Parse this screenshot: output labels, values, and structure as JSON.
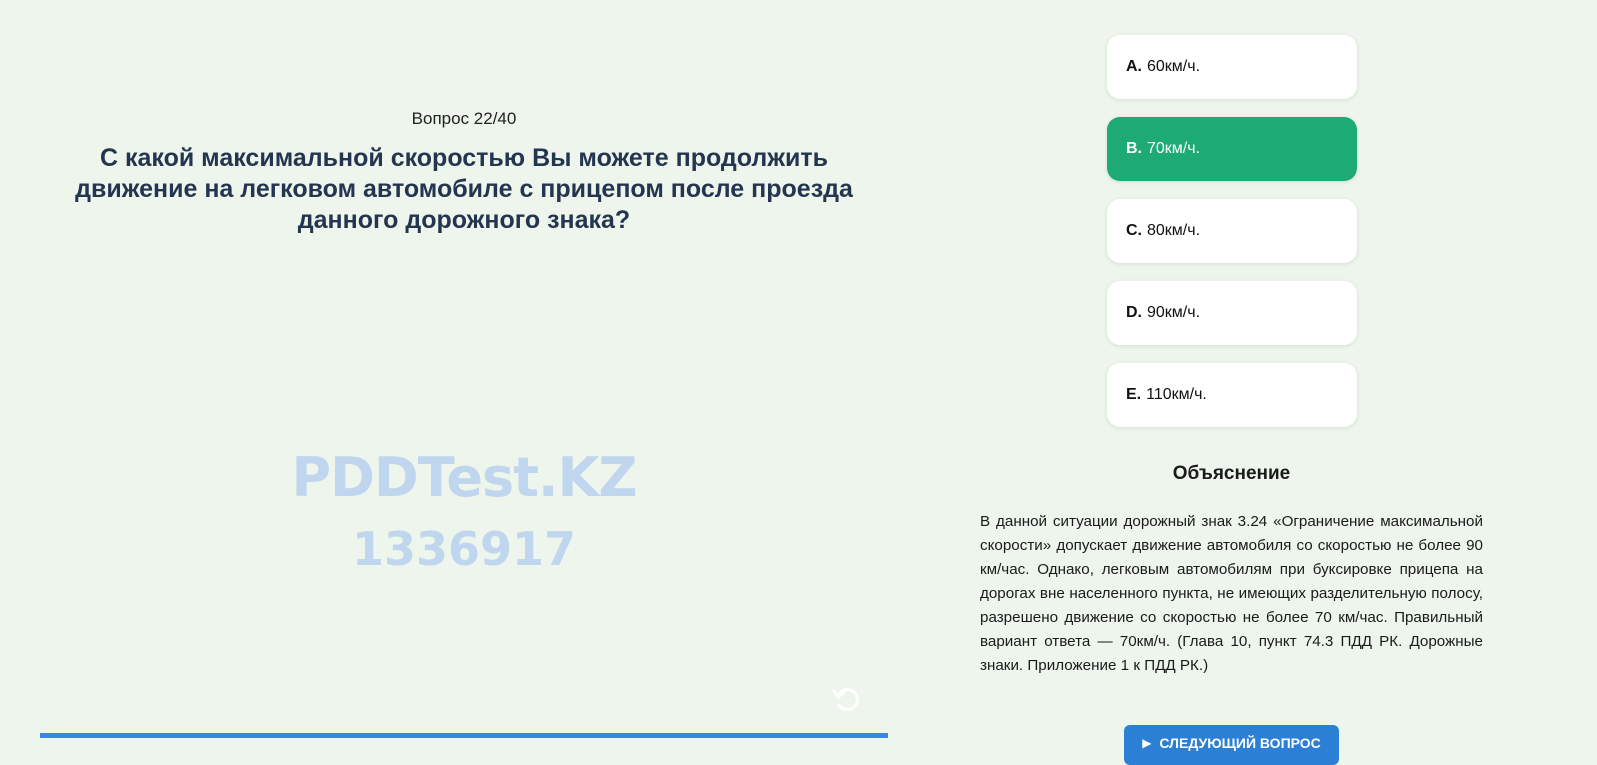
{
  "question": {
    "counter": "Вопрос 22/40",
    "text": "С какой максимальной скоростью Вы можете продолжить движение на легковом автомобиле с прицепом после проезда данного дорожного знака?"
  },
  "watermark": {
    "line1": "PDDTest.KZ",
    "line2": "1336917"
  },
  "progress": {
    "fraction": 1.0
  },
  "options": [
    {
      "letter": "A.",
      "text": "60км/ч.",
      "selected": false
    },
    {
      "letter": "B.",
      "text": "70км/ч.",
      "selected": true
    },
    {
      "letter": "C.",
      "text": "80км/ч.",
      "selected": false
    },
    {
      "letter": "D.",
      "text": "90км/ч.",
      "selected": false
    },
    {
      "letter": "E.",
      "text": "110км/ч.",
      "selected": false
    }
  ],
  "explanation": {
    "title": "Объяснение",
    "text": "В данной ситуации дорожный знак 3.24 «Ограничение максимальной скорости» допускает движение автомобиля со скоростью не более 90 км/час. Однако, легковым автомобилям при буксировке прицепа на дорогах вне населенного пункта, не имеющих разделительную полосу, разрешено движение со скоростью не более 70 км/час. Правильный вариант ответа — 70км/ч. (Глава 10, пункт 74.3 ПДД РК. Дорожные знаки. Приложение 1 к ПДД РК.)"
  },
  "next_button": {
    "label": "Следующий вопрос",
    "icon": "play-icon"
  },
  "icons": {
    "replay": "replay-icon"
  },
  "colors": {
    "background": "#edf5ec",
    "selected_option": "#1daa75",
    "progress": "#3b87e0",
    "button": "#2b7fd4",
    "watermark": "#bfd6ee",
    "question_text": "#243550"
  }
}
